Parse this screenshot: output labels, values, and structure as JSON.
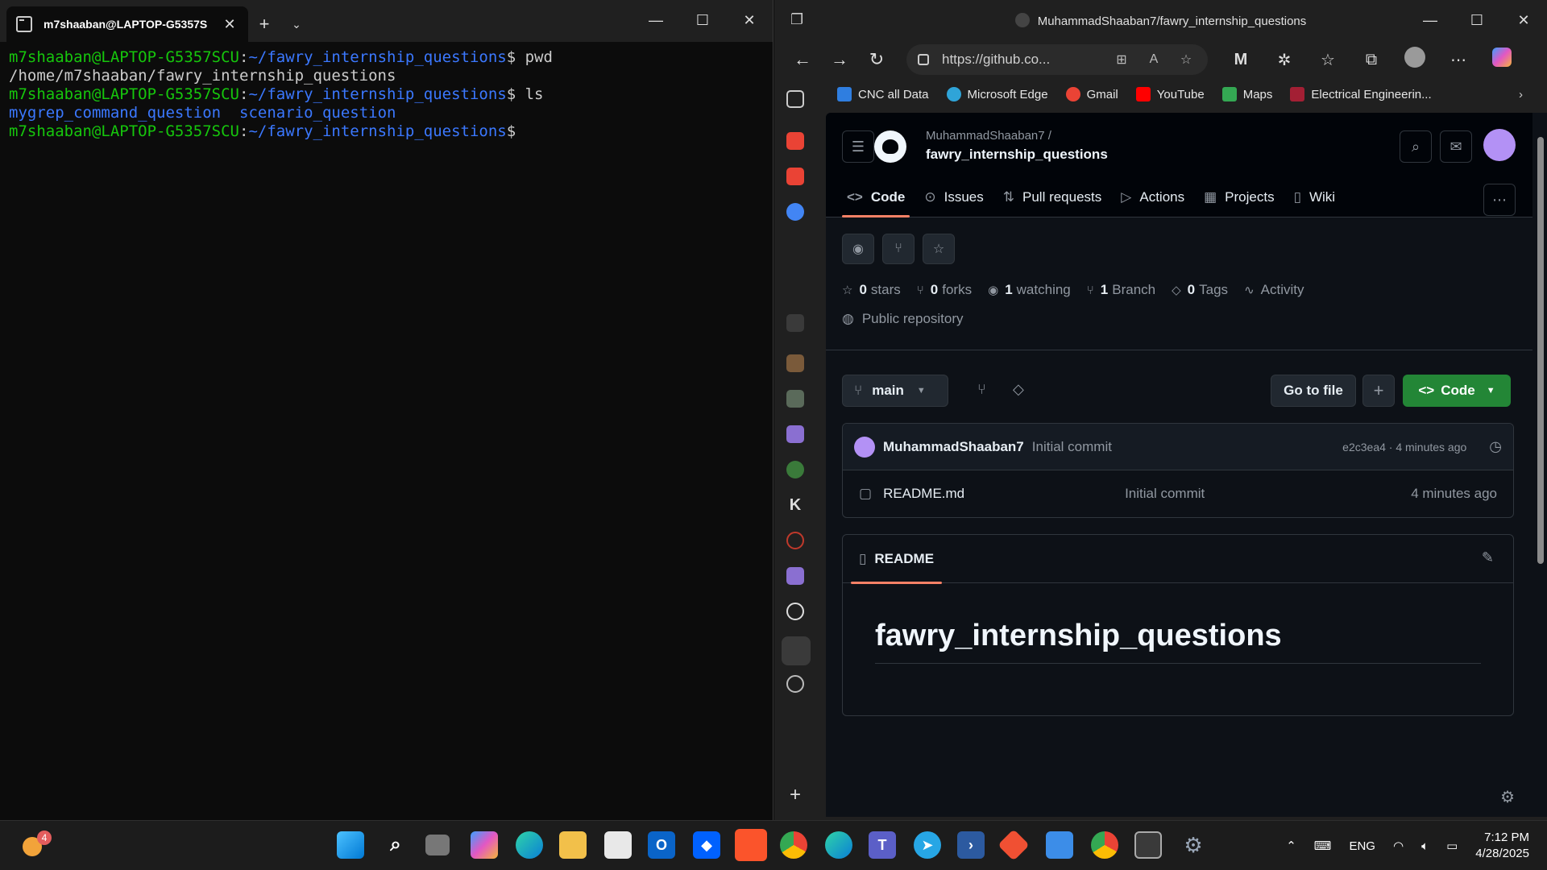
{
  "terminal": {
    "tab_title": "m7shaaban@LAPTOP-G5357S",
    "lines": {
      "l1_user": "m7shaaban@LAPTOP-G5357SCU",
      "l1_sep": ":",
      "l1_path": "~/fawry_internship_questions",
      "l1_cmd": "$ pwd",
      "l2": "/home/m7shaaban/fawry_internship_questions",
      "l3_user": "m7shaaban@LAPTOP-G5357SCU",
      "l3_sep": ":",
      "l3_path": "~/fawry_internship_questions",
      "l3_cmd": "$ ls",
      "l4_a": "mygrep_command_question",
      "l4_b": "scenario_question",
      "l5_user": "m7shaaban@LAPTOP-G5357SCU",
      "l5_sep": ":",
      "l5_path": "~/fawry_internship_questions",
      "l5_cmd": "$"
    }
  },
  "browser": {
    "window_title": "MuhammadShaaban7/fawry_internship_questions",
    "address": "https://github.co...",
    "favorites": [
      {
        "label": "CNC all Data",
        "color": "#2f7ee0"
      },
      {
        "label": "Microsoft Edge",
        "color": "#2fa4d8"
      },
      {
        "label": "Gmail",
        "color": "#ea4335"
      },
      {
        "label": "YouTube",
        "color": "#ff0000"
      },
      {
        "label": "Maps",
        "color": "#34a853"
      },
      {
        "label": "Electrical Engineerin...",
        "color": "#a31f34"
      }
    ]
  },
  "github": {
    "owner": "MuhammadShaaban7 /",
    "repo": "fawry_internship_questions",
    "tabs": {
      "code": "Code",
      "issues": "Issues",
      "pulls": "Pull requests",
      "actions": "Actions",
      "projects": "Projects",
      "wiki": "Wiki"
    },
    "stats": {
      "stars_count": "0",
      "stars_label": "stars",
      "forks_count": "0",
      "forks_label": "forks",
      "watching_count": "1",
      "watching_label": "watching",
      "branch_count": "1",
      "branch_label": "Branch",
      "tags_count": "0",
      "tags_label": "Tags",
      "activity_label": "Activity"
    },
    "visibility": "Public repository",
    "branch": "main",
    "go_to_file": "Go to file",
    "code_button": "Code",
    "commit": {
      "author": "MuhammadShaaban7",
      "message": "Initial commit",
      "meta": "e2c3ea4 · 4 minutes ago"
    },
    "files": [
      {
        "name": "README.md",
        "message": "Initial commit",
        "time": "4 minutes ago"
      }
    ],
    "readme_tab": "README",
    "readme_heading": "fawry_internship_questions"
  },
  "taskbar": {
    "weather_badge": "4",
    "lang": "ENG",
    "time": "7:12 PM",
    "date": "4/28/2025"
  },
  "colors": {
    "terminal_user": "#16c60c",
    "terminal_path": "#3b78ff",
    "gh_accent": "#f78166",
    "gh_green": "#238636"
  }
}
